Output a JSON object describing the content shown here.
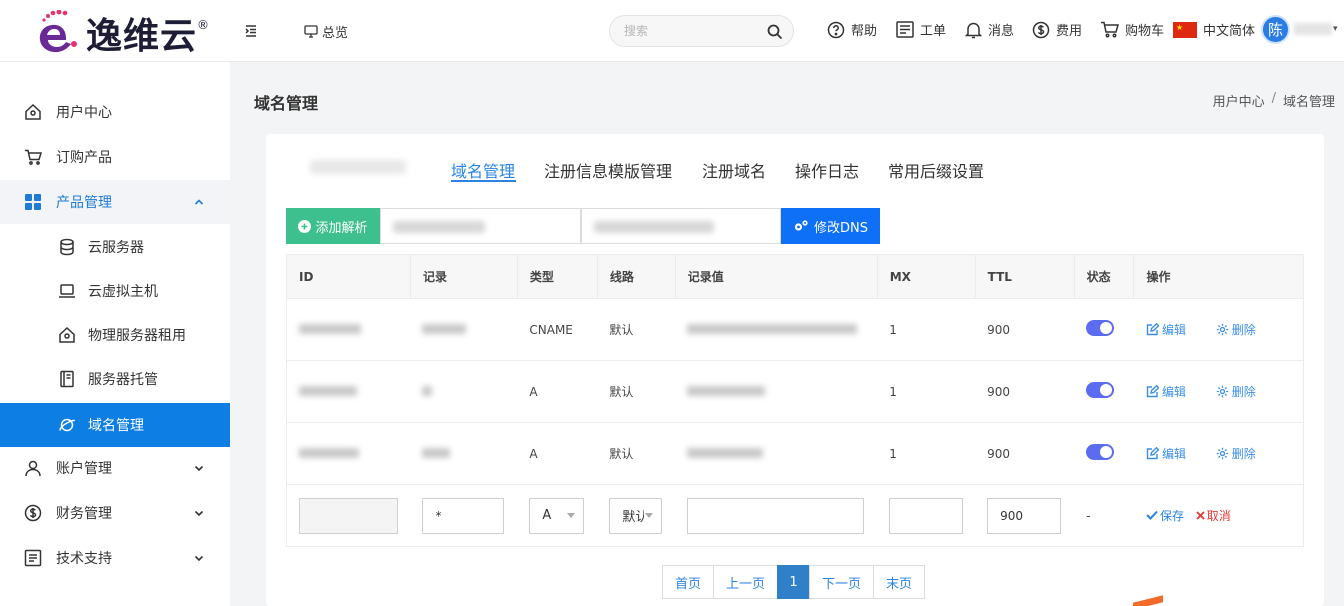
{
  "header": {
    "logo_text": "逸维云",
    "logo_reg": "®",
    "overview_label": "总览",
    "search_placeholder": "搜索",
    "help": "帮助",
    "ticket": "工单",
    "messages": "消息",
    "billing": "费用",
    "cart": "购物车",
    "language": "中文简体",
    "avatar_char": "陈"
  },
  "sidebar": {
    "items": [
      {
        "label": "用户中心",
        "icon": "home-icon"
      },
      {
        "label": "订购产品",
        "icon": "cart-icon"
      },
      {
        "label": "产品管理",
        "icon": "grid-icon",
        "expanded": true
      },
      {
        "label": "云服务器",
        "icon": "database-icon"
      },
      {
        "label": "云虚拟主机",
        "icon": "laptop-icon"
      },
      {
        "label": "物理服务器租用",
        "icon": "home-icon"
      },
      {
        "label": "服务器托管",
        "icon": "book-icon"
      },
      {
        "label": "域名管理",
        "icon": "planet-icon",
        "active": true
      },
      {
        "label": "账户管理",
        "icon": "user-icon"
      },
      {
        "label": "财务管理",
        "icon": "dollar-icon"
      },
      {
        "label": "技术支持",
        "icon": "list-icon"
      }
    ]
  },
  "page": {
    "title": "域名管理",
    "breadcrumb": [
      "用户中心",
      "/",
      "域名管理"
    ]
  },
  "tabs": [
    "域名管理",
    "注册信息模版管理",
    "注册域名",
    "操作日志",
    "常用后缀设置"
  ],
  "toolbar": {
    "add_label": "添加解析",
    "dns_label": "修改DNS"
  },
  "table": {
    "columns": [
      "ID",
      "记录",
      "类型",
      "线路",
      "记录值",
      "MX",
      "TTL",
      "状态",
      "操作"
    ],
    "rows": [
      {
        "type": "CNAME",
        "line": "默认",
        "mx": "1",
        "ttl": "900",
        "enabled": true
      },
      {
        "type": "A",
        "line": "默认",
        "mx": "1",
        "ttl": "900",
        "enabled": true
      },
      {
        "type": "A",
        "line": "默认",
        "mx": "1",
        "ttl": "900",
        "enabled": true
      }
    ],
    "edit_label": "编辑",
    "delete_label": "删除",
    "new_row": {
      "record": "*",
      "type": "A",
      "line": "默认",
      "ttl": "900",
      "status": "-",
      "save_label": "保存",
      "cancel_label": "取消"
    }
  },
  "pagination": [
    "首页",
    "上一页",
    "1",
    "下一页",
    "末页"
  ],
  "colors": {
    "primary": "#0d7ee4",
    "add_button": "#3dc08d",
    "dns_button": "#0e6ff7",
    "toggle_on": "#5c6cf0",
    "cancel": "#e53935"
  }
}
